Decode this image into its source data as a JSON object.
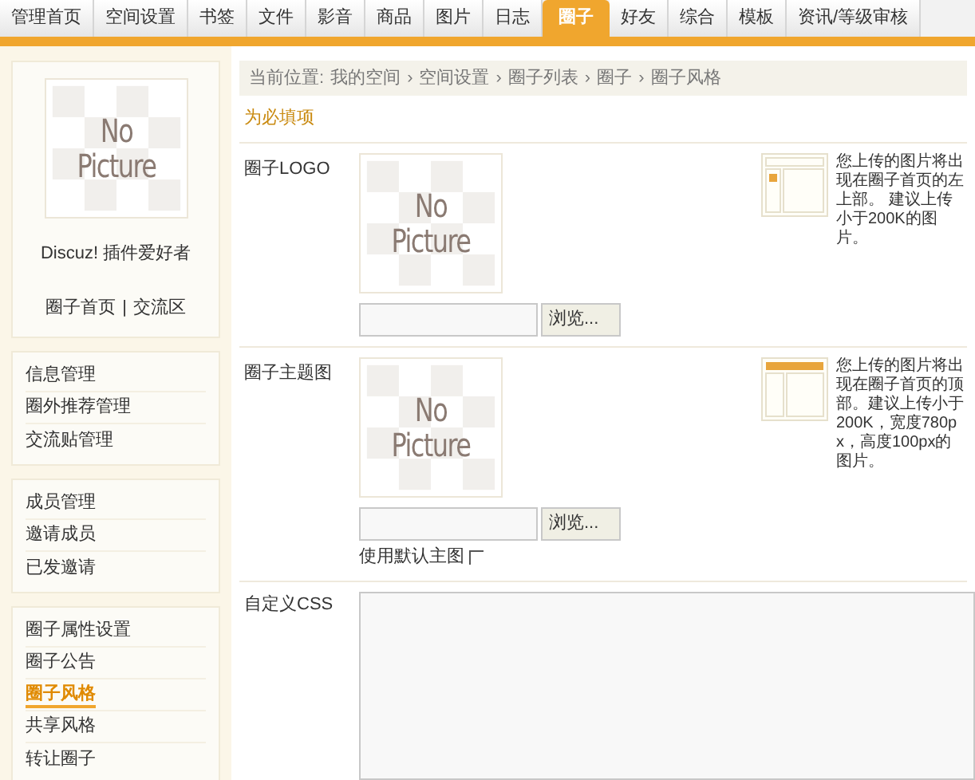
{
  "tabs": [
    {
      "label": "管理首页",
      "selected": false
    },
    {
      "label": "空间设置",
      "selected": false
    },
    {
      "label": "书签",
      "selected": false
    },
    {
      "label": "文件",
      "selected": false
    },
    {
      "label": "影音",
      "selected": false
    },
    {
      "label": "商品",
      "selected": false
    },
    {
      "label": "图片",
      "selected": false
    },
    {
      "label": "日志",
      "selected": false
    },
    {
      "label": "圈子",
      "selected": true
    },
    {
      "label": "好友",
      "selected": false
    },
    {
      "label": "综合",
      "selected": false
    },
    {
      "label": "模板",
      "selected": false
    },
    {
      "label": "资讯/等级审核",
      "selected": false
    }
  ],
  "profile": {
    "picture_lines": [
      "No",
      "Picture"
    ],
    "name": "Discuz! 插件爱好者",
    "links": [
      "圈子首页",
      "交流区"
    ],
    "separator": "|"
  },
  "menu_groups": [
    {
      "items": [
        {
          "label": "信息管理",
          "selected": false
        },
        {
          "label": "圈外推荐管理",
          "selected": false
        },
        {
          "label": "交流贴管理",
          "selected": false
        }
      ]
    },
    {
      "items": [
        {
          "label": "成员管理",
          "selected": false
        },
        {
          "label": "邀请成员",
          "selected": false
        },
        {
          "label": "已发邀请",
          "selected": false
        }
      ]
    },
    {
      "items": [
        {
          "label": "圈子属性设置",
          "selected": false
        },
        {
          "label": "圈子公告",
          "selected": false
        },
        {
          "label": "圈子风格",
          "selected": true
        },
        {
          "label": "共享风格",
          "selected": false
        },
        {
          "label": "转让圈子",
          "selected": false
        }
      ]
    }
  ],
  "breadcrumb": {
    "prefix": "当前位置:",
    "items": [
      "我的空间",
      "空间设置",
      "圈子列表",
      "圈子",
      "圈子风格"
    ],
    "separator": "›"
  },
  "required_note": "为必填项",
  "form_rows": [
    {
      "kind": "upload",
      "label": "圈子LOGO",
      "picture_lines": [
        "No",
        "Picture"
      ],
      "browse": "浏览...",
      "highlight_top": false,
      "hint": "您上传的图片将出现在圈子首页的左上部。 建议上传小于200K的图片。"
    },
    {
      "kind": "upload",
      "label": "圈子主题图",
      "picture_lines": [
        "No",
        "Picture"
      ],
      "browse": "浏览...",
      "highlight_top": true,
      "hint": "您上传的图片将出现在圈子首页的顶部。建议上传小于200K，宽度780px，高度100px的图片。",
      "default_option": {
        "label": "使用默认主图",
        "checked": false
      }
    },
    {
      "kind": "textarea",
      "label": "自定义CSS"
    }
  ]
}
